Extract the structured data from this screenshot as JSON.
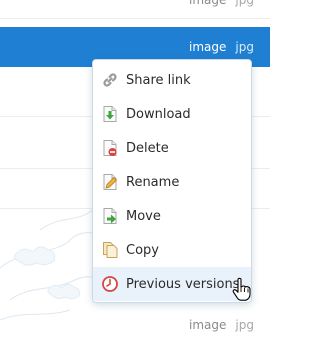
{
  "rows": [
    {
      "type": "image",
      "ext": "jpg",
      "selected": false
    },
    {
      "type": "image",
      "ext": "jpg",
      "selected": true
    },
    {
      "type": "image",
      "ext": "jpg",
      "selected": false
    }
  ],
  "menu": {
    "items": [
      {
        "label": "Share link",
        "icon": "link-icon"
      },
      {
        "label": "Download",
        "icon": "download-icon"
      },
      {
        "label": "Delete",
        "icon": "delete-icon"
      },
      {
        "label": "Rename",
        "icon": "rename-icon"
      },
      {
        "label": "Move",
        "icon": "move-icon"
      },
      {
        "label": "Copy",
        "icon": "copy-icon"
      },
      {
        "label": "Previous versions",
        "icon": "clock-icon",
        "hovered": true
      }
    ]
  },
  "colors": {
    "selected_row": "#1f7fd3",
    "menu_hover": "#e9f2fb",
    "menu_border": "#c9dbea"
  }
}
